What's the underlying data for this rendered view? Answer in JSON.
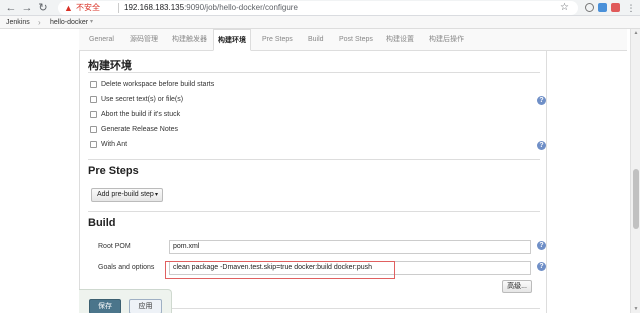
{
  "browser": {
    "security_label": "不安全",
    "url_host": "192.168.183.135",
    "url_rest": ":9090/job/hello-docker/configure"
  },
  "breadcrumb": {
    "items": [
      "Jenkins",
      "hello-docker"
    ]
  },
  "tabs": [
    "General",
    "源码管理",
    "构建触发器",
    "构建环境",
    "Pre Steps",
    "Build",
    "Post Steps",
    "构建设置",
    "构建后操作"
  ],
  "active_tab": "构建环境",
  "build_env": {
    "title": "构建环境",
    "options": [
      {
        "label": "Delete workspace before build starts",
        "checked": false
      },
      {
        "label": "Use secret text(s) or file(s)",
        "checked": false
      },
      {
        "label": "Abort the build if it's stuck",
        "checked": false
      },
      {
        "label": "Generate Release Notes",
        "checked": false
      },
      {
        "label": "With Ant",
        "checked": false
      }
    ]
  },
  "pre_steps": {
    "title": "Pre Steps",
    "add_button": "Add pre-build step"
  },
  "build": {
    "title": "Build",
    "root_pom_label": "Root POM",
    "root_pom_value": "pom.xml",
    "goals_label": "Goals and options",
    "goals_value": "clean package -Dmaven.test.skip=true docker:build docker:push",
    "advanced_button": "高级..."
  },
  "actions": {
    "save": "保存",
    "apply": "应用"
  },
  "icons": {
    "help": "?",
    "caret": "▾"
  },
  "colors": {
    "save_button": "#4b758b",
    "help_icon": "#6f8fc7",
    "highlight": "#e06060"
  }
}
